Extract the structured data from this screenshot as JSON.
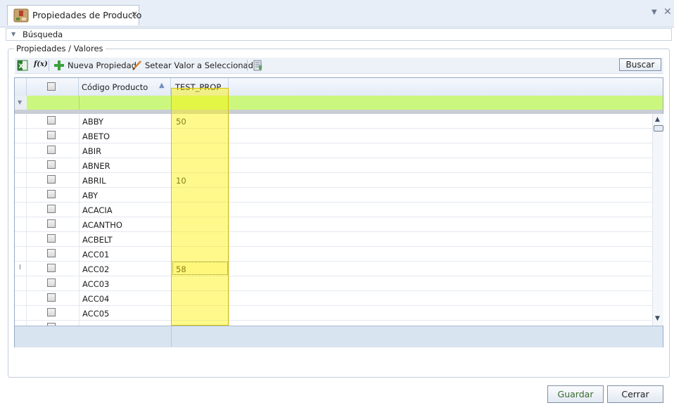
{
  "tab": {
    "title": "Propiedades de Producto",
    "close_glyph": "×"
  },
  "window": {
    "menu_glyph": "▼",
    "close_glyph": "✕"
  },
  "busqueda": {
    "label": "Búsqueda"
  },
  "group": {
    "label": "Propiedades / Valores"
  },
  "toolbar": {
    "excel_icon": "excel-icon",
    "formula_icon": "formula-icon",
    "nueva_propiedad": "Nueva Propiedad",
    "setear_valor": "Setear Valor a Seleccionadas",
    "buscar": "Buscar"
  },
  "grid": {
    "columns": {
      "code": "Código Producto",
      "test_prop": "TEST_PROP"
    },
    "rows": [
      {
        "code": "ABBY",
        "value": "50"
      },
      {
        "code": "ABETO",
        "value": ""
      },
      {
        "code": "ABIR",
        "value": ""
      },
      {
        "code": "ABNER",
        "value": ""
      },
      {
        "code": "ABRIL",
        "value": "10"
      },
      {
        "code": "ABY",
        "value": ""
      },
      {
        "code": "ACACIA",
        "value": ""
      },
      {
        "code": "ACANTHO",
        "value": ""
      },
      {
        "code": "ACBELT",
        "value": ""
      },
      {
        "code": "ACC01",
        "value": ""
      },
      {
        "code": "ACC02",
        "value": "58"
      },
      {
        "code": "ACC03",
        "value": ""
      },
      {
        "code": "ACC04",
        "value": ""
      },
      {
        "code": "ACC05",
        "value": ""
      }
    ],
    "editing_row": 10,
    "highlight_color": "#fff100",
    "filter_row_color": "#ccf77e"
  },
  "buttons": {
    "guardar": "Guardar",
    "cerrar": "Cerrar"
  }
}
